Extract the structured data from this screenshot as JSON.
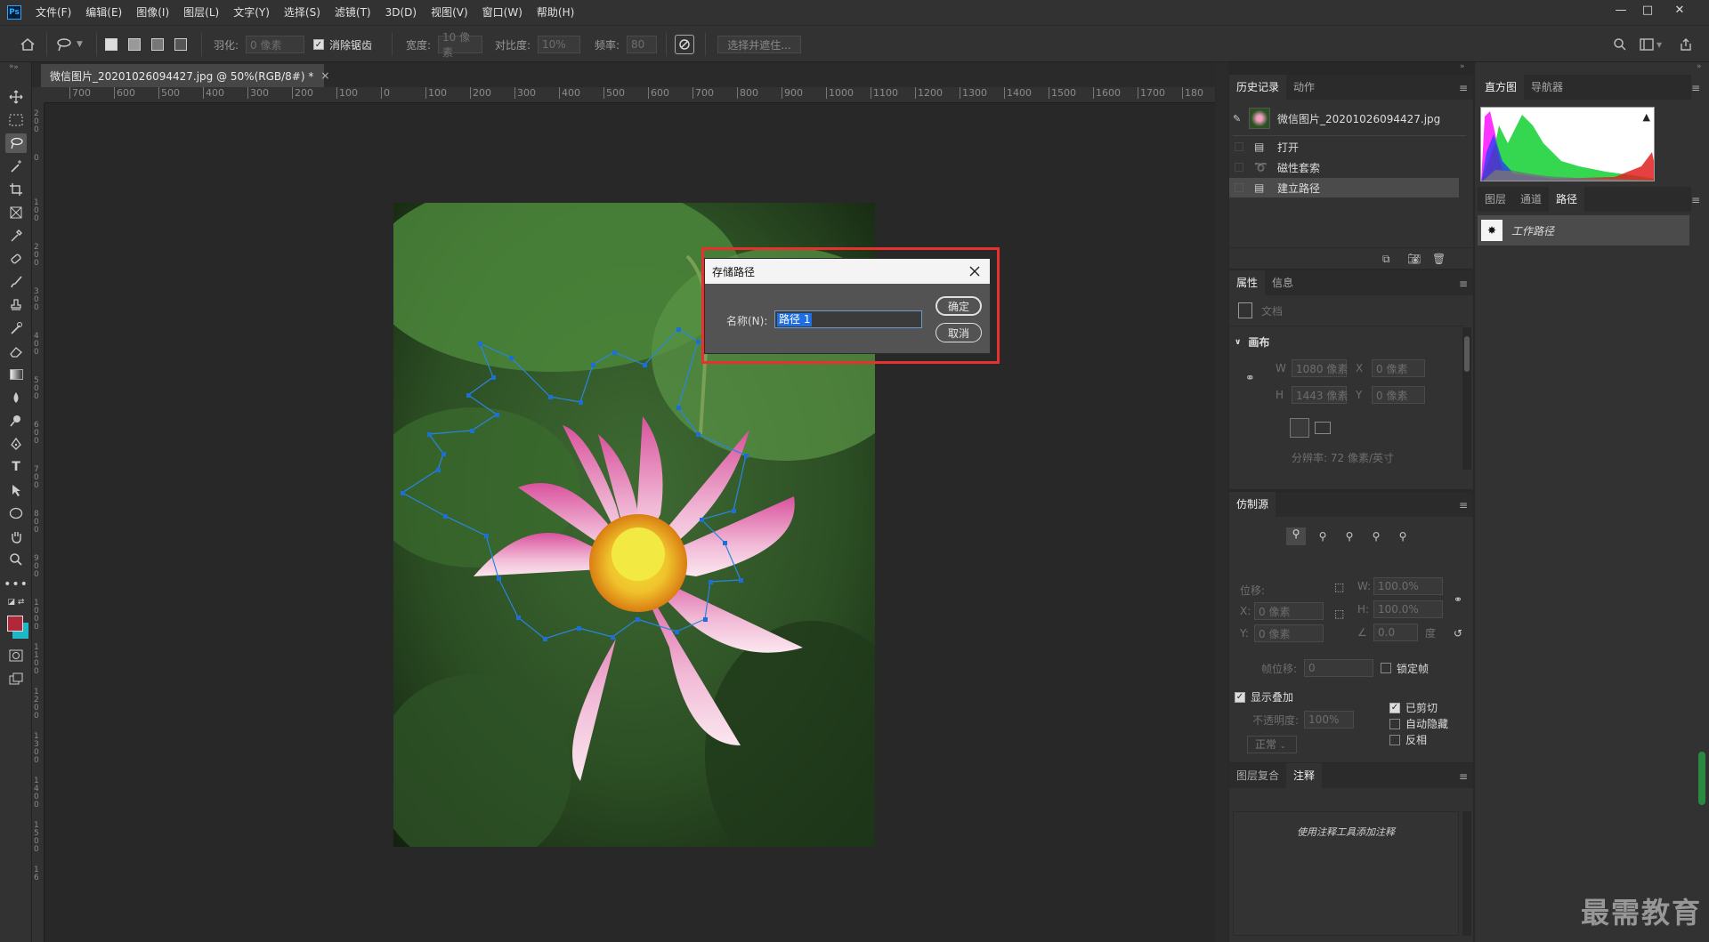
{
  "app": {
    "logo": "Ps"
  },
  "menu": [
    "文件(F)",
    "编辑(E)",
    "图像(I)",
    "图层(L)",
    "文字(Y)",
    "选择(S)",
    "滤镜(T)",
    "3D(D)",
    "视图(V)",
    "窗口(W)",
    "帮助(H)"
  ],
  "window_controls": {
    "minimize": "—",
    "maximize": "□",
    "close": "✕"
  },
  "options_bar": {
    "feather_label": "羽化:",
    "feather_value": "0 像素",
    "antialias_label": "消除锯齿",
    "width_label": "宽度:",
    "width_value": "10 像素",
    "contrast_label": "对比度:",
    "contrast_value": "10%",
    "frequency_label": "频率:",
    "frequency_value": "80",
    "select_mask_label": "选择并遮住..."
  },
  "document": {
    "tab_title": "微信图片_20201026094427.jpg @ 50%(RGB/8#) *",
    "close": "×"
  },
  "ruler": {
    "h_ticks": [
      "700",
      "600",
      "500",
      "400",
      "300",
      "200",
      "100",
      "0",
      "100",
      "200",
      "300",
      "400",
      "500",
      "600",
      "700",
      "800",
      "900",
      "1000",
      "1100",
      "1200",
      "1300",
      "1400",
      "1500",
      "1600",
      "1700",
      "180"
    ],
    "v_ticks": [
      "2 0 0",
      "0",
      "1 0 0",
      "2 0 0",
      "3 0 0",
      "4 0 0",
      "5 0 0",
      "6 0 0",
      "7 0 0",
      "8 0 0",
      "9 0 0",
      "1 0 0 0",
      "1 1 0 0",
      "1 2 0 0",
      "1 3 0 0",
      "1 4 0 0",
      "1 5 0 0",
      "1 6"
    ]
  },
  "dialog": {
    "title": "存储路径",
    "name_label": "名称(N):",
    "name_value": "路径 1",
    "ok": "确定",
    "cancel": "取消"
  },
  "history_panel": {
    "tabs": [
      "历史记录",
      "动作"
    ],
    "snapshot": "微信图片_20201026094427.jpg",
    "items": [
      "打开",
      "磁性套索",
      "建立路径"
    ]
  },
  "histogram_panel": {
    "tabs": [
      "直方图",
      "导航器"
    ]
  },
  "paths_panel": {
    "tabs": [
      "图层",
      "通道",
      "路径"
    ],
    "items": [
      "工作路径"
    ]
  },
  "properties_panel": {
    "tabs": [
      "属性",
      "信息"
    ],
    "doc_label": "文档",
    "section": "画布",
    "w_label": "W",
    "w_value": "1080 像素",
    "h_label": "H",
    "h_value": "1443 像素",
    "x_label": "X",
    "x_value": "0 像素",
    "y_label": "Y",
    "y_value": "0 像素",
    "resolution": "分辨率: 72 像素/英寸"
  },
  "clone_panel": {
    "tab": "仿制源",
    "offset_label": "位移:",
    "x_label": "X:",
    "x_value": "0 像素",
    "y_label": "Y:",
    "y_value": "0 像素",
    "w_label": "W:",
    "w_value": "100.0%",
    "h_label": "H:",
    "h_value": "100.0%",
    "angle_value": "0.0",
    "angle_unit": "度",
    "frame_offset_label": "帧位移:",
    "frame_offset_value": "0",
    "lock_frame": "锁定帧",
    "show_overlay": "显示叠加",
    "opacity_label": "不透明度:",
    "opacity_value": "100%",
    "blend_mode": "正常",
    "clipped": "已剪切",
    "auto_hide": "自动隐藏",
    "invert": "反相"
  },
  "notes_panel": {
    "tabs": [
      "图层复合",
      "注释"
    ],
    "hint": "使用注释工具添加注释"
  },
  "watermark": "最需教育",
  "colors": {
    "foreground": "#b0283a",
    "background": "#1fb8c9",
    "accent": "#e8312c",
    "selection": "#1b6fd6"
  }
}
